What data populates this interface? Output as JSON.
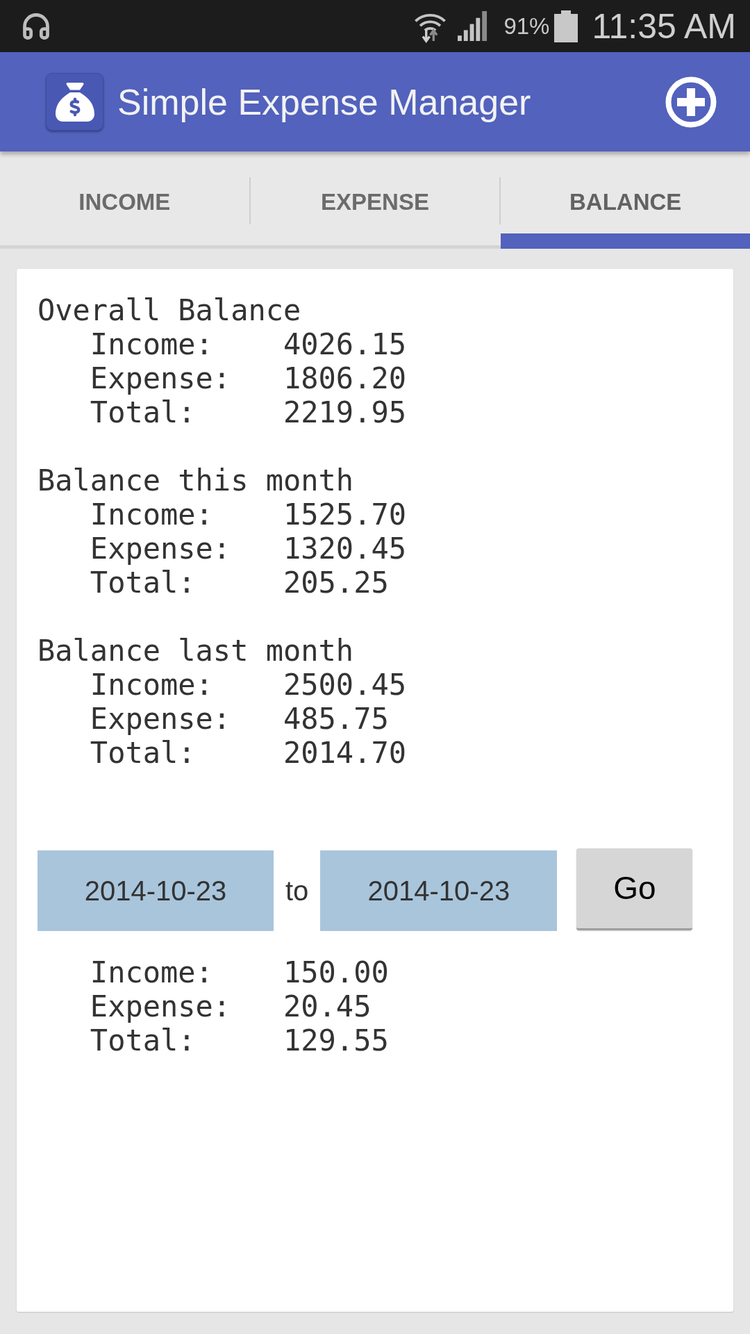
{
  "status_bar": {
    "battery": "91%",
    "time": "11:35 AM"
  },
  "app_bar": {
    "title": "Simple Expense Manager"
  },
  "tabs": [
    {
      "label": "INCOME",
      "selected": false
    },
    {
      "label": "EXPENSE",
      "selected": false
    },
    {
      "label": "BALANCE",
      "selected": true
    }
  ],
  "sections": [
    {
      "title": "Overall Balance",
      "rows": [
        {
          "label": "Income:",
          "value": "4026.15"
        },
        {
          "label": "Expense:",
          "value": "1806.20"
        },
        {
          "label": "Total:",
          "value": "2219.95"
        }
      ]
    },
    {
      "title": "Balance this month",
      "rows": [
        {
          "label": "Income:",
          "value": "1525.70"
        },
        {
          "label": "Expense:",
          "value": "1320.45"
        },
        {
          "label": "Total:",
          "value": "205.25"
        }
      ]
    },
    {
      "title": "Balance last month",
      "rows": [
        {
          "label": "Income:",
          "value": "2500.45"
        },
        {
          "label": "Expense:",
          "value": "485.75"
        },
        {
          "label": "Total:",
          "value": "2014.70"
        }
      ]
    }
  ],
  "date_range": {
    "from": "2014-10-23",
    "separator": "to",
    "to": "2014-10-23",
    "button": "Go",
    "rows": [
      {
        "label": "Income:",
        "value": "150.00"
      },
      {
        "label": "Expense:",
        "value": "20.45"
      },
      {
        "label": "Total:",
        "value": "129.55"
      }
    ]
  }
}
